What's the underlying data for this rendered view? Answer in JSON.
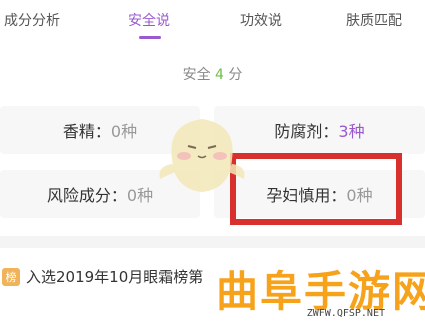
{
  "tabs": [
    {
      "label": "成分分析",
      "active": false
    },
    {
      "label": "安全说",
      "active": true
    },
    {
      "label": "功效说",
      "active": false
    },
    {
      "label": "肤质匹配",
      "active": false
    }
  ],
  "score": {
    "prefix": "安全",
    "value": "4",
    "suffix": "分"
  },
  "cards": [
    {
      "label": "香精：",
      "count": "0种"
    },
    {
      "label": "防腐剂：",
      "count": "3种"
    },
    {
      "label": "风险成分：",
      "count": "0种"
    },
    {
      "label": "孕妇慎用：",
      "count": "0种"
    }
  ],
  "colors": {
    "accent": "#9b59d0",
    "score": "#6cc04a",
    "highlight": "#d8302c",
    "watermark": "#f7a21b"
  },
  "ranking": {
    "badge": "榜",
    "text": "入选2019年10月眼霜榜第"
  },
  "watermark": {
    "text": "曲阜手游网",
    "url": "ZWFW.QFSP.NET"
  }
}
